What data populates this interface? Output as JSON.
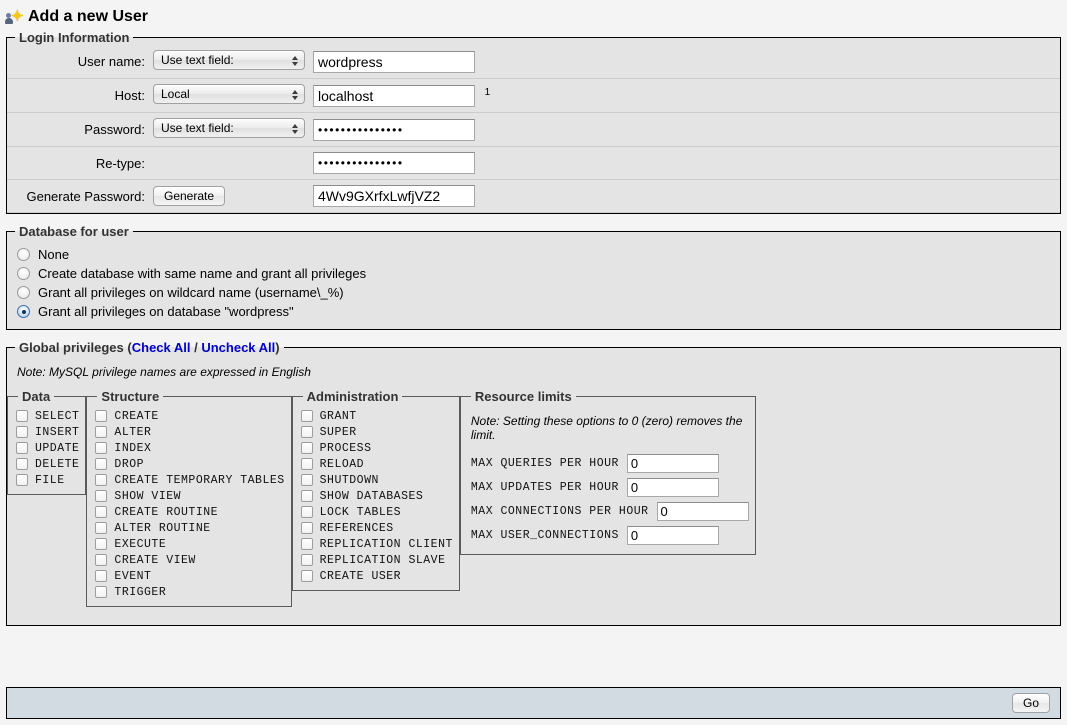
{
  "page": {
    "title": "Add a new User",
    "title_icon": "add-user-icon"
  },
  "login_information": {
    "legend": "Login Information",
    "rows": [
      {
        "label": "User name:",
        "select_value": "Use text field:",
        "input_value": "wordpress",
        "note": ""
      },
      {
        "label": "Host:",
        "select_value": "Local",
        "input_value": "localhost",
        "note": "1"
      },
      {
        "label": "Password:",
        "select_value": "Use text field:",
        "input_value": "•••••••••••••••",
        "note": ""
      },
      {
        "label": "Re-type:",
        "select_value": "",
        "input_value": "•••••••••••••••",
        "note": ""
      },
      {
        "label": "Generate Password:",
        "button_label": "Generate",
        "input_value": "4Wv9GXrfxLwfjVZ2",
        "note": ""
      }
    ]
  },
  "database_for_user": {
    "legend": "Database for user",
    "options": [
      {
        "label": "None",
        "selected": false
      },
      {
        "label": "Create database with same name and grant all privileges",
        "selected": false
      },
      {
        "label": "Grant all privileges on wildcard name (username\\_%)",
        "selected": false
      },
      {
        "label": "Grant all privileges on database \"wordpress\"",
        "selected": true
      }
    ]
  },
  "global_privileges": {
    "legend": "Global privileges",
    "check_all": "Check All",
    "separator": " / ",
    "uncheck_all": "Uncheck All",
    "note": "Note: MySQL privilege names are expressed in English",
    "link_color": "#0000c8",
    "groups": [
      {
        "legend": "Data",
        "items": [
          {
            "label": "SELECT",
            "checked": false
          },
          {
            "label": "INSERT",
            "checked": false
          },
          {
            "label": "UPDATE",
            "checked": false
          },
          {
            "label": "DELETE",
            "checked": false
          },
          {
            "label": "FILE",
            "checked": false
          }
        ]
      },
      {
        "legend": "Structure",
        "items": [
          {
            "label": "CREATE",
            "checked": false
          },
          {
            "label": "ALTER",
            "checked": false
          },
          {
            "label": "INDEX",
            "checked": false
          },
          {
            "label": "DROP",
            "checked": false
          },
          {
            "label": "CREATE TEMPORARY TABLES",
            "checked": false
          },
          {
            "label": "SHOW VIEW",
            "checked": false
          },
          {
            "label": "CREATE ROUTINE",
            "checked": false
          },
          {
            "label": "ALTER ROUTINE",
            "checked": false
          },
          {
            "label": "EXECUTE",
            "checked": false
          },
          {
            "label": "CREATE VIEW",
            "checked": false
          },
          {
            "label": "EVENT",
            "checked": false
          },
          {
            "label": "TRIGGER",
            "checked": false
          }
        ]
      },
      {
        "legend": "Administration",
        "items": [
          {
            "label": "GRANT",
            "checked": false
          },
          {
            "label": "SUPER",
            "checked": false
          },
          {
            "label": "PROCESS",
            "checked": false
          },
          {
            "label": "RELOAD",
            "checked": false
          },
          {
            "label": "SHUTDOWN",
            "checked": false
          },
          {
            "label": "SHOW DATABASES",
            "checked": false
          },
          {
            "label": "LOCK TABLES",
            "checked": false
          },
          {
            "label": "REFERENCES",
            "checked": false
          },
          {
            "label": "REPLICATION CLIENT",
            "checked": false
          },
          {
            "label": "REPLICATION SLAVE",
            "checked": false
          },
          {
            "label": "CREATE USER",
            "checked": false
          }
        ]
      }
    ],
    "resource_limits": {
      "legend": "Resource limits",
      "note": "Note: Setting these options to 0 (zero) removes the limit.",
      "fields": [
        {
          "label": "MAX QUERIES PER HOUR",
          "value": "0"
        },
        {
          "label": "MAX UPDATES PER HOUR",
          "value": "0"
        },
        {
          "label": "MAX CONNECTIONS PER HOUR",
          "value": "0"
        },
        {
          "label": "MAX USER_CONNECTIONS",
          "value": "0"
        }
      ]
    }
  },
  "footer": {
    "go_label": "Go",
    "background": "#d2dae2"
  }
}
